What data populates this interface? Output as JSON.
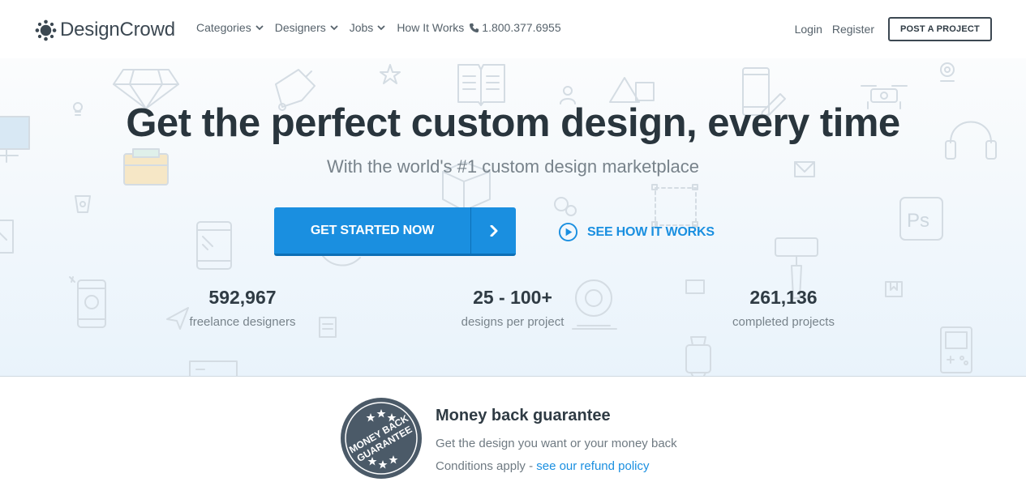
{
  "header": {
    "brand": "DesignCrowd",
    "nav": [
      {
        "label": "Categories",
        "dropdown": true
      },
      {
        "label": "Designers",
        "dropdown": true
      },
      {
        "label": "Jobs",
        "dropdown": true
      },
      {
        "label": "How It Works",
        "dropdown": false
      }
    ],
    "phone": "1.800.377.6955",
    "login": "Login",
    "register": "Register",
    "post_project": "POST A PROJECT"
  },
  "hero": {
    "title": "Get the perfect custom design, every time",
    "subtitle": "With the world's #1 custom design marketplace",
    "cta_label": "GET STARTED NOW",
    "how_label": "SEE HOW IT WORKS",
    "stats": [
      {
        "value": "592,967",
        "label": "freelance designers"
      },
      {
        "value": "25 - 100+",
        "label": "designs per project"
      },
      {
        "value": "261,136",
        "label": "completed projects"
      }
    ]
  },
  "guarantee": {
    "badge_line1": "MONEY BACK",
    "badge_line2": "GUARANTEE",
    "title": "Money back guarantee",
    "line1": "Get the design you want or your money back",
    "line2_prefix": "Conditions apply - ",
    "link": "see our refund policy"
  },
  "colors": {
    "accent": "#1a8fe0",
    "accent_dark": "#0d6fb5",
    "text_dark": "#2f3b44",
    "text_muted": "#78838b",
    "badge": "#4b5a68"
  },
  "icons": [
    "designcrowd-logo-icon",
    "chevron-down-icon",
    "phone-icon",
    "chevron-right-icon",
    "play-circle-icon",
    "money-back-badge-icon"
  ]
}
